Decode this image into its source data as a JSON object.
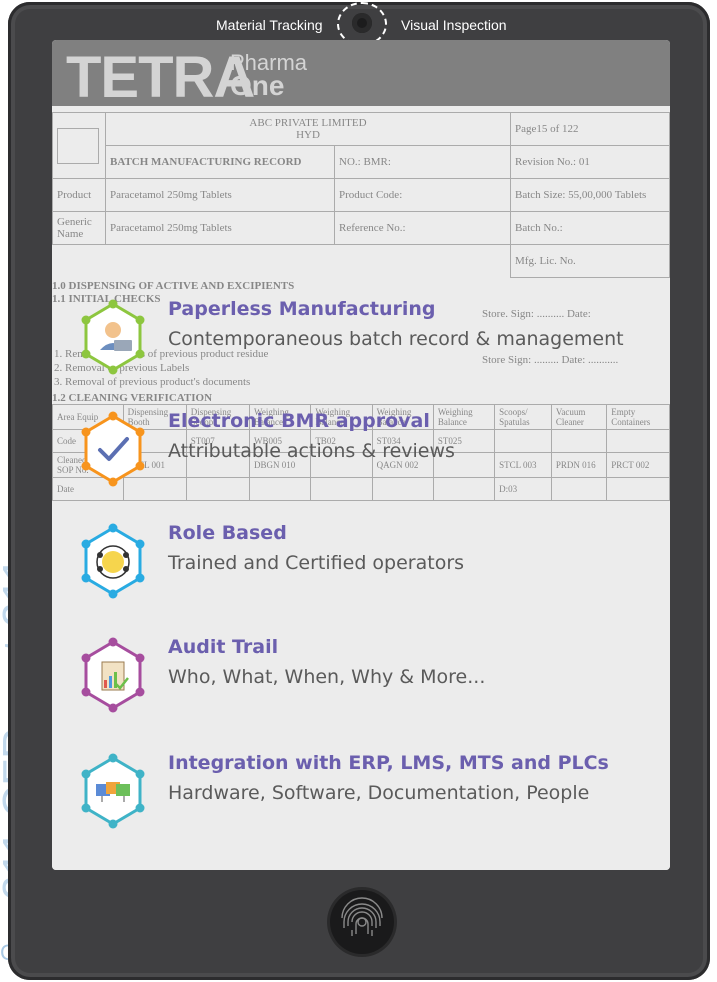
{
  "background_text": [
    "211 CFR part 211 ou",
    "CR"
  ],
  "tablet": {
    "top_left_label": "Material Tracking",
    "top_right_label": "Visual Inspection",
    "camera_icon": "camera-icon",
    "fingerprint_icon": "fingerprint-icon"
  },
  "logo": {
    "main": "TETRA",
    "sub_top": "Pharma",
    "sub_bottom": "One"
  },
  "document": {
    "company": "ABC PRIVATE LIMITED",
    "city": "HYD",
    "page": "Page15 of 122",
    "title": "BATCH MANUFACTURING RECORD",
    "no_bmr": "NO.: BMR:",
    "revision": "Revision No.: 01",
    "product_label": "Product",
    "product_value": "Paracetamol 250mg Tablets",
    "product_code": "Product Code:",
    "batch_size": "Batch Size: 55,00,000 Tablets",
    "generic_label": "Generic Name",
    "generic_value": "Paracetamol 250mg Tablets",
    "reference": "Reference No.:",
    "batch_no": "Batch No.:",
    "mfg_lic": "Mfg. Lic. No.",
    "section1": "1.0 DISPENSING OF ACTIVE AND EXCIPIENTS",
    "section1_1": "1.1 INITIAL CHECKS",
    "store_sign1": "Store. Sign: .......... Date:",
    "check_lines": [
      "1.  Removal of traces of previous product residue",
      "2.  Removal of previous Labels",
      "3.  Removal of previous product's documents"
    ],
    "store_sign2": "Store Sign: .........        Date: ...........",
    "section1_2": "1.2 CLEANING VERIFICATION",
    "clean_headers": [
      "Area Equip",
      "Dispensing Booth",
      "Dispensing Scoop",
      "Weighing Balance",
      "Weighing Balance",
      "Weighing Balance",
      "Weighing Balance",
      "Scoops/ Spatulas",
      "Vacuum Cleaner",
      "Empty Containers"
    ],
    "clean_row1": [
      "Code",
      "508",
      "ST007",
      "WB005",
      "TB02",
      "ST034",
      "ST025",
      "",
      "",
      ""
    ],
    "clean_row2": [
      "Cleaned as per SOP No.",
      "STCL 001",
      "",
      "DBGN 010",
      "",
      "QAGN 002",
      "",
      "STCL 003",
      "PRDN 016",
      "PRCT 002"
    ],
    "clean_row3": [
      "Date",
      "",
      "",
      "",
      "",
      "",
      "",
      "D:03",
      "",
      ""
    ]
  },
  "features": [
    {
      "title": "Paperless Manufacturing",
      "description": "Contemporaneous batch record & management",
      "icon": "operator-laptop-icon",
      "color": "#8dc63f"
    },
    {
      "title": "Electronic BMR approval",
      "description": "Attributable actions & reviews",
      "icon": "checkmark-icon",
      "color": "#f7941d"
    },
    {
      "title": "Role Based",
      "description": "Trained and Certified operators",
      "icon": "role-network-icon",
      "color": "#29abe2"
    },
    {
      "title": "Audit Trail",
      "description": "Who, What, When, Why & More...",
      "icon": "audit-clipboard-icon",
      "color": "#a64d9e"
    },
    {
      "title": "Integration with ERP, LMS, MTS and PLCs",
      "description": "Hardware, Software, Documentation, People",
      "icon": "integration-screens-icon",
      "color": "#3fb3c7"
    }
  ]
}
